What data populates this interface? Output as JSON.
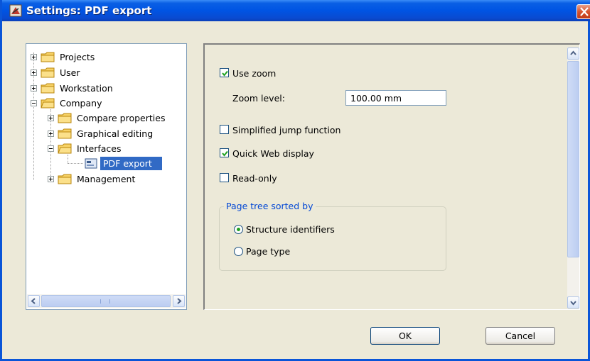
{
  "window": {
    "title": "Settings: PDF export",
    "icon": "settings-app-icon",
    "close_icon": "close-icon"
  },
  "tree": {
    "items": [
      {
        "label": "Projects",
        "expander": "plus"
      },
      {
        "label": "User",
        "expander": "plus"
      },
      {
        "label": "Workstation",
        "expander": "plus"
      },
      {
        "label": "Company",
        "expander": "minus"
      },
      {
        "label": "Compare properties",
        "expander": "plus"
      },
      {
        "label": "Graphical editing",
        "expander": "plus"
      },
      {
        "label": "Interfaces",
        "expander": "minus"
      },
      {
        "label": "PDF export",
        "selected": true
      },
      {
        "label": "Management",
        "expander": "plus"
      }
    ],
    "scroll_thumb_grip": "III"
  },
  "options": {
    "use_zoom": {
      "label": "Use zoom",
      "checked": true
    },
    "zoom_level": {
      "label": "Zoom level:",
      "value": "100.00 mm"
    },
    "simplified_jump": {
      "label": "Simplified jump function",
      "checked": false
    },
    "quick_web": {
      "label": "Quick Web display",
      "checked": true
    },
    "read_only": {
      "label": "Read-only",
      "checked": false
    }
  },
  "page_tree": {
    "title": "Page tree sorted by",
    "options": [
      {
        "label": "Structure identifiers",
        "selected": true
      },
      {
        "label": "Page type",
        "selected": false
      }
    ]
  },
  "buttons": {
    "ok": "OK",
    "cancel": "Cancel"
  },
  "colors": {
    "titlebar": "#0054e3",
    "selection": "#316ac5",
    "group_title": "#0046d5",
    "checkmark": "#21a121"
  }
}
